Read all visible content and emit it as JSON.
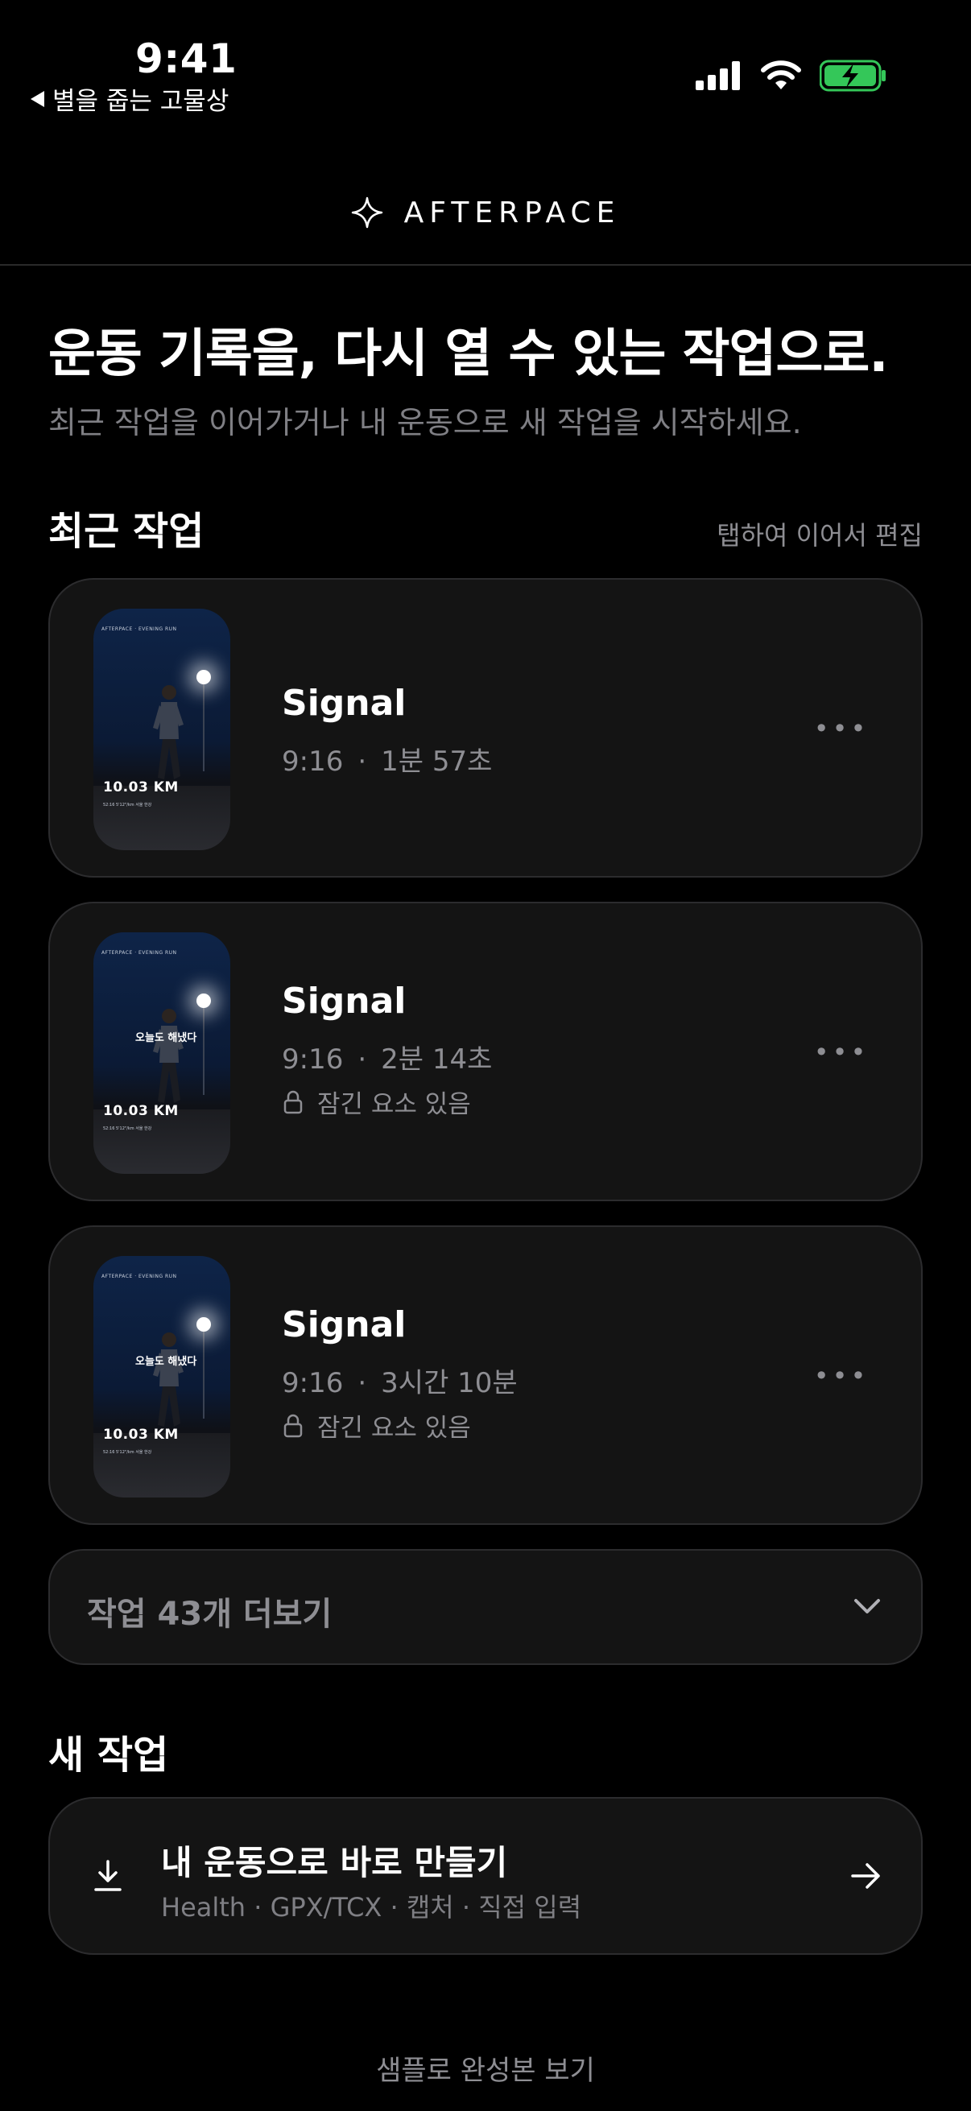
{
  "status_bar": {
    "time": "9:41",
    "back_app": "별을 줍는 고물상"
  },
  "header": {
    "brand": "AFTERPACE"
  },
  "hero": {
    "title": "운동 기록을, 다시 열 수 있는 작업으로.",
    "subtitle": "최근 작업을 이어가거나 내 운동으로 새 작업을 시작하세요."
  },
  "recent": {
    "title": "최근 작업",
    "hint": "탭하여 이어서 편집",
    "thumbnail": {
      "top_caption": "AFTERPACE · EVENING RUN",
      "distance": "10.03 KM",
      "stats": "52:16   5'12\"/km   서울 한강",
      "overlay_text": "오늘도 해냈다"
    },
    "items": [
      {
        "title": "Signal",
        "ratio": "9:16",
        "dot": "·",
        "duration": "1분 57초",
        "lock_label": ""
      },
      {
        "title": "Signal",
        "ratio": "9:16",
        "dot": "·",
        "duration": "2분 14초",
        "lock_label": "잠긴 요소 있음"
      },
      {
        "title": "Signal",
        "ratio": "9:16",
        "dot": "·",
        "duration": "3시간 10분",
        "lock_label": "잠긴 요소 있음"
      }
    ],
    "more_label": "작업 43개 더보기"
  },
  "new_work": {
    "title": "새 작업",
    "card_title": "내 운동으로 바로 만들기",
    "card_subtitle": "Health · GPX/TCX · 캡처 · 직접 입력"
  },
  "footer": {
    "sample_link": "샘플로 완성본 보기"
  },
  "colors": {
    "background": "#000000",
    "card": "#141414",
    "muted_text": "#8e8e93",
    "battery": "#34c759"
  },
  "icons": [
    "sparkle-icon",
    "lock-icon",
    "more-icon",
    "chevron-down-icon",
    "download-icon",
    "arrow-right-icon",
    "signal-icon",
    "wifi-icon",
    "battery-charging-icon"
  ]
}
